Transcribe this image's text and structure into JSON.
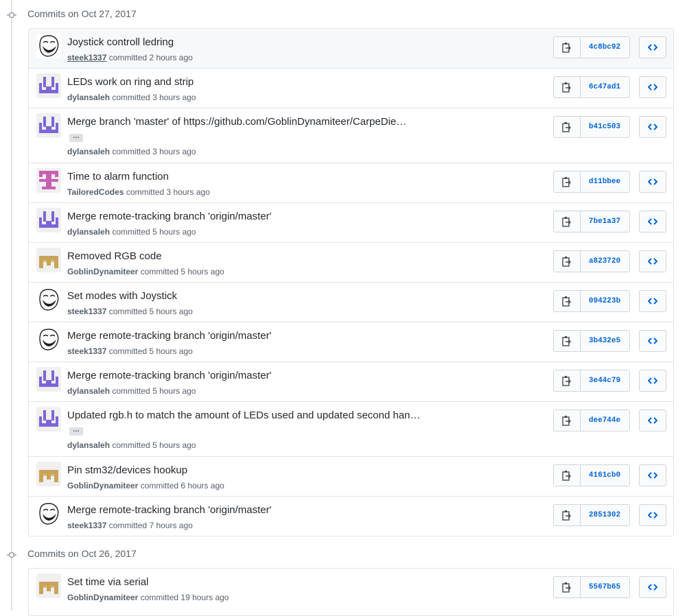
{
  "groups": [
    {
      "header": "Commits on Oct 27, 2017",
      "commits": [
        {
          "title": "Joystick controll ledring",
          "author": "steek1337",
          "verb": "committed",
          "time": "2 hours ago",
          "sha": "4c8bc92",
          "avatar": "trollface-avatar"
        },
        {
          "title": "LEDs work on ring and strip",
          "author": "dylansaleh",
          "verb": "committed",
          "time": "3 hours ago",
          "sha": "6c47ad1",
          "avatar": "purple-identicon"
        },
        {
          "title": "Merge branch 'master' of https://github.com/GoblinDynamiteer/CarpeDie…",
          "author": "dylansaleh",
          "verb": "committed",
          "time": "3 hours ago",
          "sha": "b41c503",
          "avatar": "purple-identicon",
          "ellipsis": "…"
        },
        {
          "title": "Time to alarm function",
          "author": "TailoredCodes",
          "verb": "committed",
          "time": "3 hours ago",
          "sha": "d11bbee",
          "avatar": "pink-identicon"
        },
        {
          "title": "Merge remote-tracking branch 'origin/master'",
          "author": "dylansaleh",
          "verb": "committed",
          "time": "5 hours ago",
          "sha": "7be1a37",
          "avatar": "purple-identicon"
        },
        {
          "title": "Removed RGB code",
          "author": "GoblinDynamiteer",
          "verb": "committed",
          "time": "5 hours ago",
          "sha": "a823720",
          "avatar": "gold-identicon"
        },
        {
          "title": "Set modes with Joystick",
          "author": "steek1337",
          "verb": "committed",
          "time": "5 hours ago",
          "sha": "094223b",
          "avatar": "trollface-avatar"
        },
        {
          "title": "Merge remote-tracking branch 'origin/master'",
          "author": "steek1337",
          "verb": "committed",
          "time": "5 hours ago",
          "sha": "3b432e5",
          "avatar": "trollface-avatar"
        },
        {
          "title": "Merge remote-tracking branch 'origin/master'",
          "author": "dylansaleh",
          "verb": "committed",
          "time": "5 hours ago",
          "sha": "3e44c79",
          "avatar": "purple-identicon"
        },
        {
          "title": "Updated rgb.h to match the amount of LEDs used and updated second han…",
          "author": "dylansaleh",
          "verb": "committed",
          "time": "5 hours ago",
          "sha": "dee744e",
          "avatar": "purple-identicon",
          "ellipsis": "…"
        },
        {
          "title": "Pin stm32/devices hookup",
          "author": "GoblinDynamiteer",
          "verb": "committed",
          "time": "6 hours ago",
          "sha": "4161cb0",
          "avatar": "gold-identicon"
        },
        {
          "title": "Merge remote-tracking branch 'origin/master'",
          "author": "steek1337",
          "verb": "committed",
          "time": "7 hours ago",
          "sha": "2851302",
          "avatar": "trollface-avatar"
        }
      ]
    },
    {
      "header": "Commits on Oct 26, 2017",
      "commits": [
        {
          "title": "Set time via serial",
          "author": "GoblinDynamiteer",
          "verb": "committed",
          "time": "19 hours ago",
          "sha": "5567b65",
          "avatar": "gold-identicon"
        }
      ]
    }
  ],
  "colors": {
    "link": "#0366d6",
    "purple": "#7d65d8",
    "pink": "#c85fb4",
    "gold": "#c8a45a"
  }
}
